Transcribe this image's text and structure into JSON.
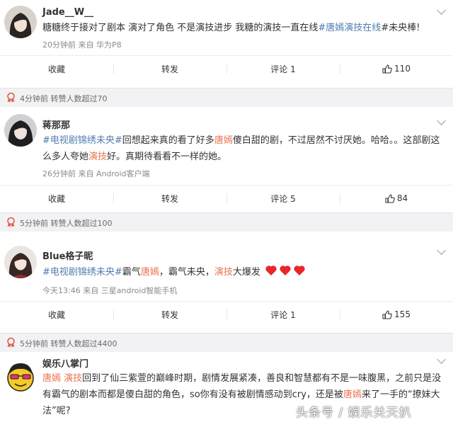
{
  "posts": [
    {
      "user": "Jade__W__",
      "content": [
        {
          "t": "糖糖终于接对了剧本 演对了角色 不是演技进步 我糖的演技一直在线",
          "c": ""
        },
        {
          "t": "#唐嫣演技在线",
          "c": "tag"
        },
        {
          "t": "#未央棒!",
          "c": ""
        }
      ],
      "meta": "20分钟前  来自 华为P8",
      "actions": {
        "collect": "收藏",
        "repost": "转发",
        "comment": "评论 1",
        "like": "110"
      }
    },
    {
      "hot": "4分钟前  转赞人数超过70",
      "user": "蒋那那",
      "content": [
        {
          "t": "#电视剧锦绣未央#",
          "c": "tag"
        },
        {
          "t": "回想起来真的看了好多",
          "c": ""
        },
        {
          "t": "唐嫣",
          "c": "hl"
        },
        {
          "t": "傻白甜的剧，不过居然不讨厌她。哈哈。。这部剧这么多人夸她",
          "c": ""
        },
        {
          "t": "演技",
          "c": "hl"
        },
        {
          "t": "好。真期待看看不一样的她。",
          "c": ""
        }
      ],
      "meta": "26分钟前  来自 Android客户端",
      "actions": {
        "collect": "收藏",
        "repost": "转发",
        "comment": "评论 5",
        "like": "84"
      }
    },
    {
      "hot": "5分钟前  转赞人数超过100",
      "user": "Blue格子昵",
      "content": [
        {
          "t": "#电视剧锦绣未央#",
          "c": "tag"
        },
        {
          "t": "霸气",
          "c": ""
        },
        {
          "t": "唐嫣",
          "c": "hl"
        },
        {
          "t": "，霸气未央，",
          "c": ""
        },
        {
          "t": "演技",
          "c": "hl"
        },
        {
          "t": "大爆发",
          "c": ""
        }
      ],
      "meta": "今天13:46  来自 三星android智能手机",
      "actions": {
        "collect": "收藏",
        "repost": "转发",
        "comment": "评论 1",
        "like": "155"
      }
    },
    {
      "hot": "5分钟前  转赞人数超过4400",
      "user": "娱乐八掌门",
      "content": [
        {
          "t": "唐嫣",
          "c": "hl"
        },
        {
          "t": " ",
          "c": ""
        },
        {
          "t": "演技",
          "c": "hl"
        },
        {
          "t": "回到了仙三紫萱的巅峰时期，剧情发展紧凑，善良和智慧都有不是一味腹黑，之前只是没有霸气的剧本而都是傻白甜的角色，so你有没有被剧情感动到cry，还是被",
          "c": ""
        },
        {
          "t": "唐嫣",
          "c": "hl"
        },
        {
          "t": "来了一手的“撩妹大法”呢?",
          "c": ""
        }
      ]
    }
  ],
  "watermark": "头条号 / 娱乐关天扒"
}
